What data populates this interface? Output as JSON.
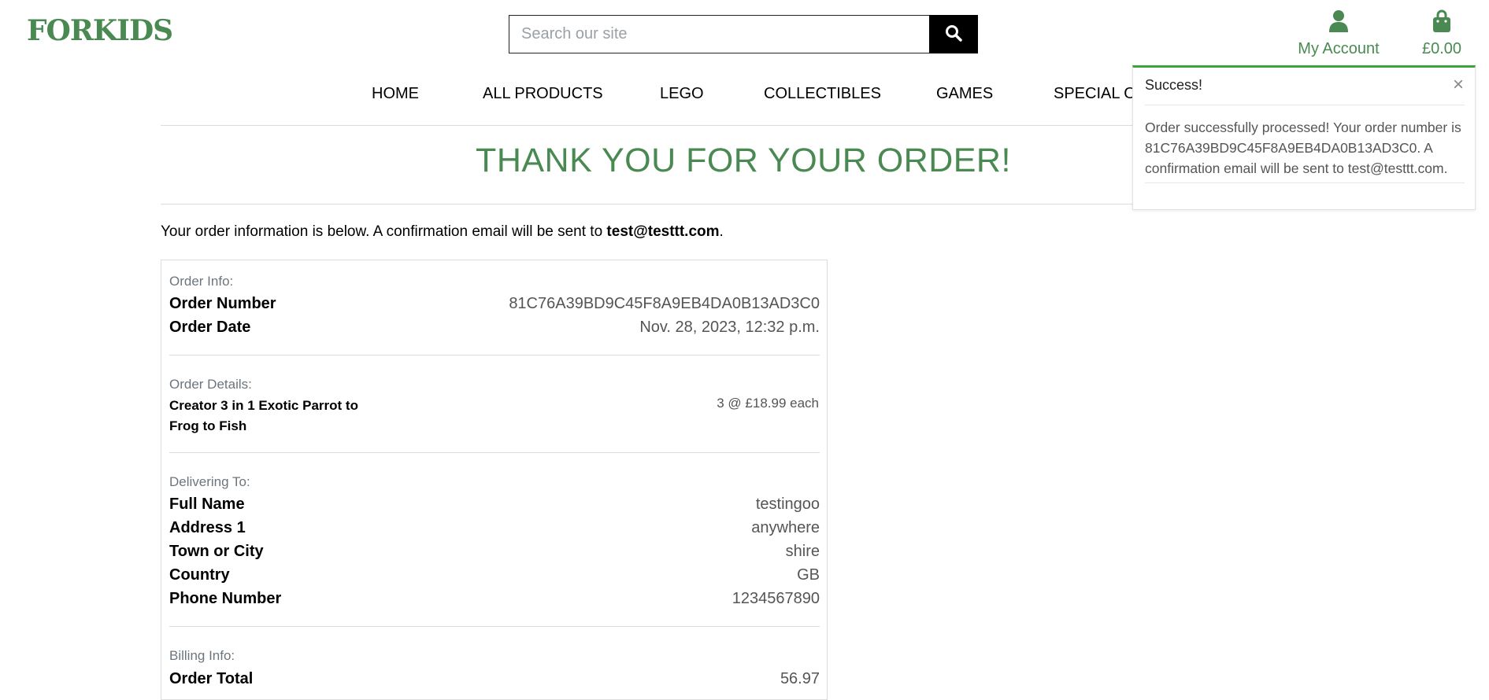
{
  "brand": {
    "logo": "FORKIDS",
    "accent": "#4a8a52"
  },
  "search": {
    "placeholder": "Search our site",
    "icon": "search-icon"
  },
  "header": {
    "account_label": "My Account",
    "account_icon": "user-icon",
    "cart_total": "£0.00",
    "cart_icon": "shopping-bag-icon"
  },
  "nav": {
    "items": [
      "HOME",
      "ALL PRODUCTS",
      "LEGO",
      "COLLECTIBLES",
      "GAMES",
      "SPECIAL OFFERS"
    ]
  },
  "page": {
    "title": "THANK YOU FOR YOUR ORDER!",
    "intro_text": "Your order information is below. A confirmation email will be sent to ",
    "intro_email": "test@testtt.com",
    "intro_end": "."
  },
  "order_info": {
    "label": "Order Info:",
    "rows": [
      {
        "key": "Order Number",
        "value": "81C76A39BD9C45F8A9EB4DA0B13AD3C0"
      },
      {
        "key": "Order Date",
        "value": "Nov. 28, 2023, 12:32 p.m."
      }
    ]
  },
  "order_details": {
    "label": "Order Details:",
    "items": [
      {
        "name": "Creator 3 in 1 Exotic Parrot to Frog to Fish",
        "qty": "3 @ £18.99 each"
      }
    ]
  },
  "delivery": {
    "label": "Delivering To:",
    "rows": [
      {
        "key": "Full Name",
        "value": "testingoo"
      },
      {
        "key": "Address 1",
        "value": "anywhere"
      },
      {
        "key": "Town or City",
        "value": "shire"
      },
      {
        "key": "Country",
        "value": "GB"
      },
      {
        "key": "Phone Number",
        "value": "1234567890"
      }
    ]
  },
  "billing": {
    "label": "Billing Info:",
    "rows": [
      {
        "key": "Order Total",
        "value": "56.97"
      }
    ]
  },
  "toast": {
    "header": "Success!",
    "close": "×",
    "close_icon": "close-icon",
    "message": "Order successfully processed! Your order number is 81C76A39BD9C45F8A9EB4DA0B13AD3C0. A confirmation email will be sent to test@testtt.com.",
    "status_color": "#3ca33f"
  }
}
